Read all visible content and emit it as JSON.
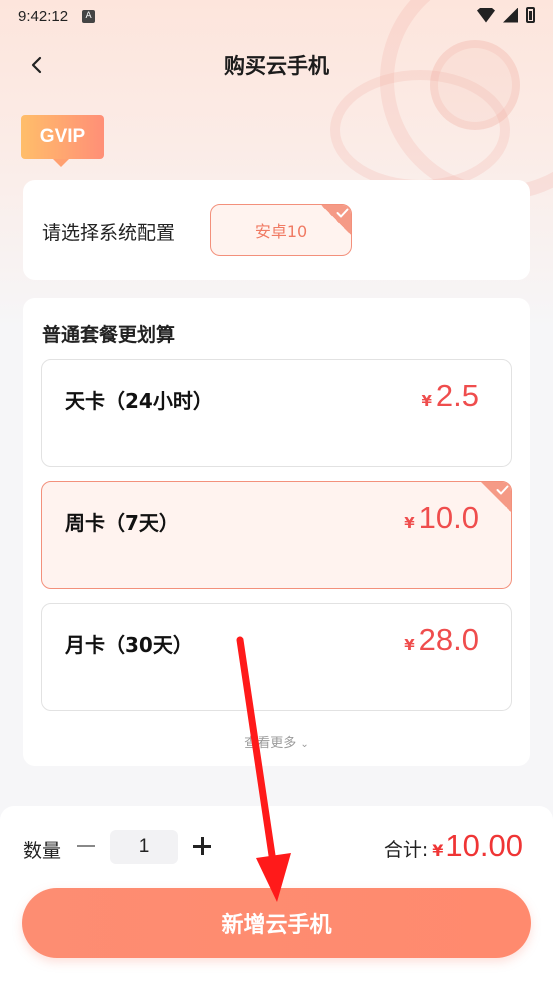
{
  "status_bar": {
    "time": "9:42:12",
    "notification_glyph": "A"
  },
  "nav": {
    "title": "购买云手机"
  },
  "vip_badge": "GVIP",
  "config": {
    "label": "请选择系统配置",
    "selected_option": "安卓10"
  },
  "plans": {
    "heading": "普通套餐更划算",
    "currency": "¥",
    "items": [
      {
        "name": "天卡（24小时）",
        "price": "2.5",
        "selected": false
      },
      {
        "name": "周卡（7天）",
        "price": "10.0",
        "selected": true
      },
      {
        "name": "月卡（30天）",
        "price": "28.0",
        "selected": false
      }
    ],
    "see_more": "查看更多"
  },
  "purchase": {
    "quantity_label": "数量",
    "quantity": "1",
    "total_label": "合计:",
    "currency": "¥",
    "total": "10.00",
    "cta_label": "新增云手机"
  },
  "colors": {
    "accent": "#f3907b",
    "price_red": "#ef4d4d",
    "cta": "#fd8d72",
    "annotation_arrow": "#ff1a1a"
  },
  "icons": {
    "back": "chevron-left-icon",
    "check": "check-icon",
    "see_more": "chevron-down-icon",
    "minus": "minus-icon",
    "plus": "plus-icon"
  }
}
